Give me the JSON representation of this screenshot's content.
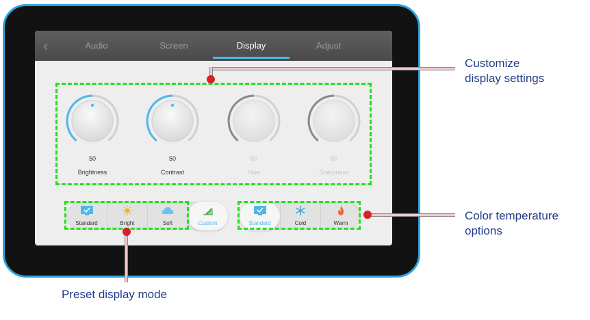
{
  "tabs": [
    {
      "label": "Audio"
    },
    {
      "label": "Screen"
    },
    {
      "label": "Display"
    },
    {
      "label": "Adjust"
    }
  ],
  "active_tab": "Display",
  "knobs": [
    {
      "label": "Brightness",
      "value": "50",
      "enabled": true
    },
    {
      "label": "Contrast",
      "value": "50",
      "enabled": true
    },
    {
      "label": "Hue",
      "value": "50",
      "enabled": false
    },
    {
      "label": "Sharpness",
      "value": "50",
      "enabled": false
    }
  ],
  "preset_modes": [
    {
      "label": "Standard",
      "icon": "monitor-check-icon"
    },
    {
      "label": "Bright",
      "icon": "sun-icon"
    },
    {
      "label": "Soft",
      "icon": "cloud-icon"
    },
    {
      "label": "Custom",
      "icon": "custom-pencil-icon"
    }
  ],
  "preset_selected": "Custom",
  "color_temps": [
    {
      "label": "Standard",
      "icon": "monitor-check-icon"
    },
    {
      "label": "Cold",
      "icon": "snowflake-icon"
    },
    {
      "label": "Warm",
      "icon": "flame-icon"
    }
  ],
  "color_temp_selected": "Standard",
  "callouts": {
    "customize": [
      "Customize",
      "display settings"
    ],
    "color_temp": [
      "Color temperature",
      "options"
    ],
    "preset": "Preset display mode"
  },
  "colors": {
    "accent": "#4fb7ea",
    "bezel_border": "#2fa3dc",
    "highlight_dash": "#22e01e",
    "callout_dot": "#d2232a",
    "callout_text": "#1f3c8a"
  }
}
